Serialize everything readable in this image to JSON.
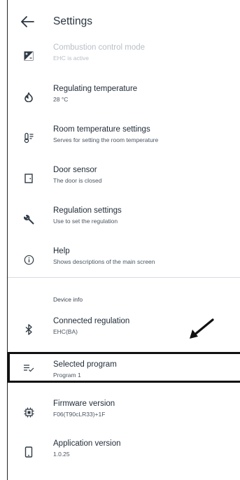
{
  "header": {
    "title": "Settings"
  },
  "items": [
    {
      "title": "Combustion control mode",
      "subtitle": "EHC is active"
    },
    {
      "title": "Regulating temperature",
      "subtitle": "28 °C"
    },
    {
      "title": "Room temperature settings",
      "subtitle": "Serves for setting the room temperature"
    },
    {
      "title": "Door sensor",
      "subtitle": "The door is closed"
    },
    {
      "title": "Regulation settings",
      "subtitle": "Use to set the regulation"
    },
    {
      "title": "Help",
      "subtitle": "Shows descriptions of the main screen"
    }
  ],
  "device_info": {
    "section_label": "Device info",
    "items": [
      {
        "title": "Connected regulation",
        "subtitle": "EHC(BA)"
      },
      {
        "title": "Selected program",
        "subtitle": "Program 1"
      },
      {
        "title": "Firmware version",
        "subtitle": "F06(T90cLR33)+1F"
      },
      {
        "title": "Application version",
        "subtitle": "1.0.25"
      }
    ]
  },
  "colors": {
    "text": "#1f2a36",
    "disabled_text": "#b9c0c7",
    "divider": "#d7dbe0",
    "highlight_border": "#111111"
  }
}
